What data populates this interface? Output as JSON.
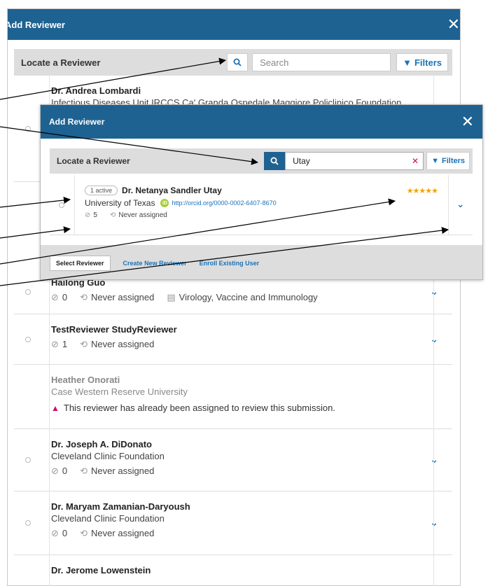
{
  "back": {
    "title": "Add Reviewer",
    "locate_title": "Locate a Reviewer",
    "search_placeholder": "Search",
    "filters_label": "Filters",
    "rows": [
      {
        "name": "Dr. Andrea Lombardi",
        "aff": "Infectious Diseases Unit IRCCS Ca' Granda Ospedale Maggiore Policlinico Foundation"
      },
      {
        "name": "Hailong Guo",
        "count": "0",
        "assigned": "Never assigned",
        "interest": "Virology, Vaccine and Immunology"
      },
      {
        "name": "TestReviewer StudyReviewer",
        "count": "1",
        "assigned": "Never assigned"
      },
      {
        "name": "Heather Onorati",
        "aff": "Case Western Reserve University",
        "warning": "This reviewer has already been assigned to review this submission."
      },
      {
        "name": "Dr. Joseph A. DiDonato",
        "aff": "Cleveland Clinic Foundation",
        "count": "0",
        "assigned": "Never assigned"
      },
      {
        "name": "Dr. Maryam Zamanian-Daryoush",
        "aff": "Cleveland Clinic Foundation",
        "count": "0",
        "assigned": "Never assigned"
      },
      {
        "name": "Dr. Jerome Lowenstein"
      }
    ]
  },
  "front": {
    "title": "Add Reviewer",
    "locate_title": "Locate a Reviewer",
    "search_value": "Utay",
    "filters_label": "Filters",
    "reviewer": {
      "badge": "1 active",
      "name": "Dr. Netanya Sandler Utay",
      "aff": "University of Texas",
      "orcid": "http://orcid.org/0000-0002-6407-8670",
      "count": "5",
      "assigned": "Never assigned",
      "stars": "★★★★★"
    },
    "footer": {
      "select": "Select Reviewer",
      "create": "Create New Reviewer",
      "enroll": "Enroll Existing User"
    }
  },
  "colors": {
    "header": "#1e6292",
    "link": "#1a73b8",
    "warn": "#d00a6c",
    "stars": "#f0a500"
  },
  "icons": [
    "search-icon",
    "filter-icon",
    "close-icon",
    "chevron-down-icon",
    "check-circle-icon",
    "history-icon",
    "book-icon",
    "warning-icon",
    "orcid-icon",
    "clear-icon"
  ]
}
